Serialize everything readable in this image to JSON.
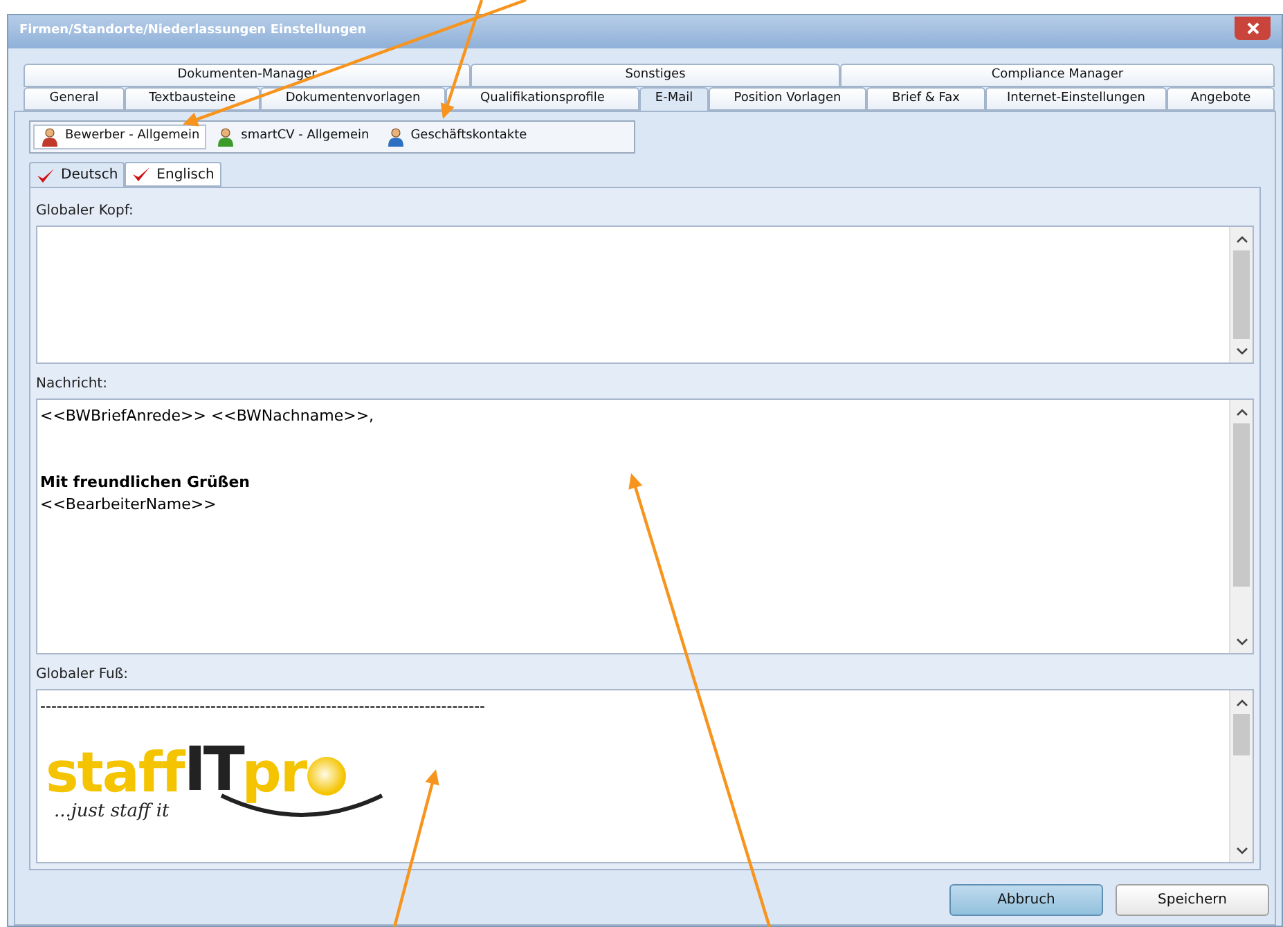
{
  "window": {
    "title": "Firmen/Standorte/Niederlassungen Einstellungen"
  },
  "tab_rows": [
    [
      {
        "label": "Dokumenten-Manager",
        "selected": false
      },
      {
        "label": "Sonstiges",
        "selected": false
      },
      {
        "label": "Compliance Manager",
        "selected": false
      }
    ],
    [
      {
        "label": "General",
        "selected": false
      },
      {
        "label": "Textbausteine",
        "selected": false
      },
      {
        "label": "Dokumentenvorlagen",
        "selected": false
      },
      {
        "label": "Qualifikationsprofile",
        "selected": false
      },
      {
        "label": "E-Mail",
        "selected": true
      },
      {
        "label": "Position Vorlagen",
        "selected": false
      },
      {
        "label": "Brief & Fax",
        "selected": false
      },
      {
        "label": "Internet-Einstellungen",
        "selected": false
      },
      {
        "label": "Angebote",
        "selected": false
      }
    ]
  ],
  "sub_tabs": [
    {
      "label": "Bewerber - Allgemein",
      "selected": true,
      "color": "#c0392b"
    },
    {
      "label": "smartCV - Allgemein",
      "selected": false,
      "color": "#3a9a2a"
    },
    {
      "label": "Geschäftskontakte",
      "selected": false,
      "color": "#2d6fc0"
    }
  ],
  "language_tabs": [
    {
      "label": "Deutsch",
      "selected": true
    },
    {
      "label": "Englisch",
      "selected": false
    }
  ],
  "sections": [
    {
      "label": "Globaler Kopf:",
      "kind": "text"
    },
    {
      "label": "Nachricht:",
      "kind": "text",
      "paragraphs": [
        {
          "lines": [
            {
              "text": "<<BWBriefAnrede>> <<BWNachname>>,",
              "bold": false
            }
          ]
        },
        {
          "lines": [
            {
              "text": "Mit freundlichen Grüßen",
              "bold": true
            },
            {
              "text": "<<BearbeiterName>>",
              "bold": false
            }
          ]
        }
      ]
    },
    {
      "label": "Globaler Fuß:",
      "kind": "logo",
      "paragraphs": [
        {
          "lines": [
            {
              "text": "---------------------------------------------------------------------------------",
              "bold": false
            }
          ]
        }
      ],
      "logo": {
        "word_1": "staff",
        "word_2": "IT",
        "word_3": "pr",
        "tagline": "...just staff it"
      }
    }
  ],
  "buttons": [
    {
      "label": "Abbruch",
      "selected": true
    },
    {
      "label": "Speichern",
      "selected": false
    }
  ]
}
